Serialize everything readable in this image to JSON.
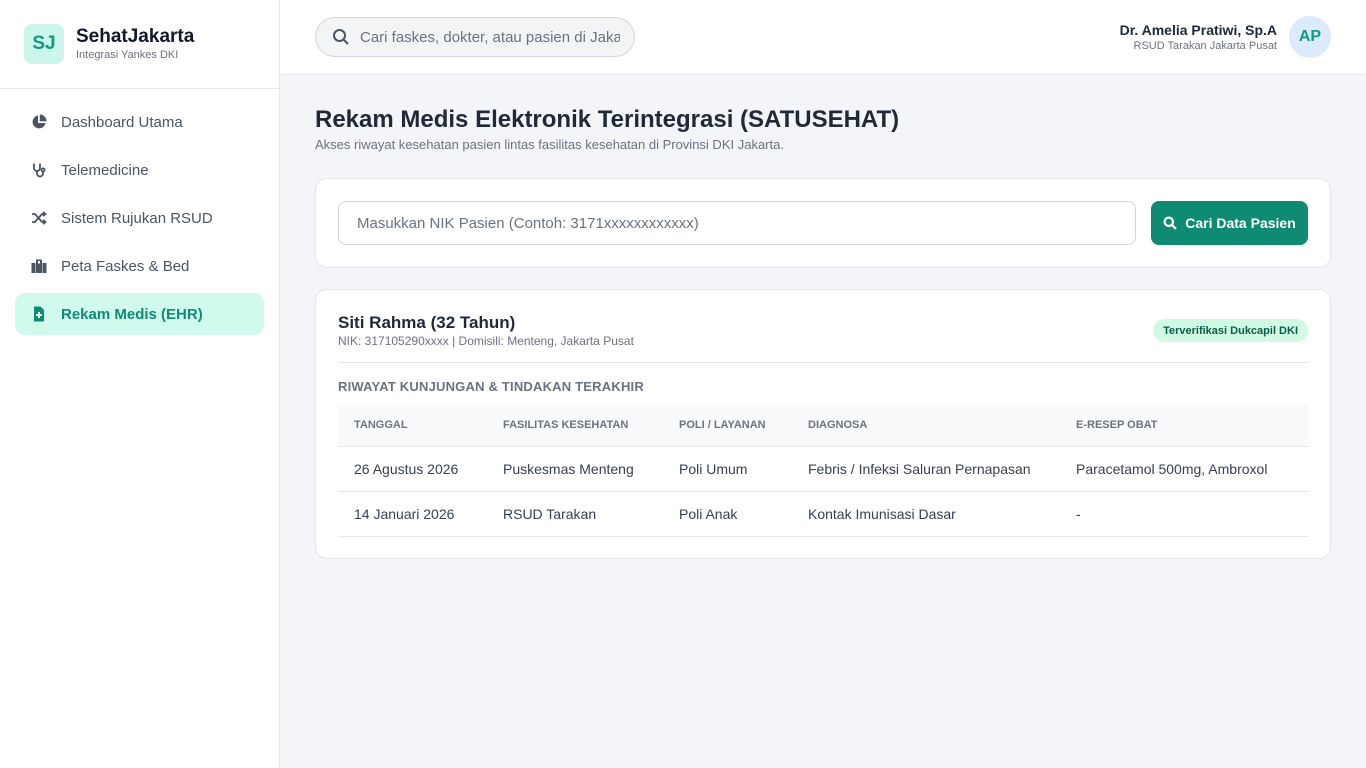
{
  "brand": {
    "logo": "SJ",
    "name": "SehatJakarta",
    "subtitle": "Integrasi Yankes DKI"
  },
  "sidebar": {
    "items": [
      {
        "label": "Dashboard Utama",
        "icon": "pie-chart-icon"
      },
      {
        "label": "Telemedicine",
        "icon": "stethoscope-icon"
      },
      {
        "label": "Sistem Rujukan RSUD",
        "icon": "shuffle-icon"
      },
      {
        "label": "Peta Faskes & Bed",
        "icon": "hospital-building-icon"
      },
      {
        "label": "Rekam Medis (EHR)",
        "icon": "medical-file-icon",
        "active": true
      }
    ]
  },
  "topbar": {
    "search_placeholder": "Cari faskes, dokter, atau pasien di Jakarta",
    "user": {
      "name": "Dr. Amelia Pratiwi, Sp.A",
      "role": "RSUD Tarakan Jakarta Pusat",
      "initials": "AP"
    }
  },
  "page": {
    "title": "Rekam Medis Elektronik Terintegrasi (SATUSEHAT)",
    "subtitle": "Akses riwayat kesehatan pasien lintas fasilitas kesehatan di Provinsi DKI Jakarta."
  },
  "nik_search": {
    "placeholder": "Masukkan NIK Pasien (Contoh: 3171xxxxxxxxxxxx)",
    "button_label": "Cari Data Pasien"
  },
  "patient": {
    "name": "Siti Rahma (32 Tahun)",
    "meta": "NIK: 317105290xxxx | Domisili: Menteng, Jakarta Pusat",
    "badge": "Terverifikasi Dukcapil DKI",
    "history_title": "RIWAYAT KUNJUNGAN & TINDAKAN TERAKHIR",
    "columns": [
      "TANGGAL",
      "FASILITAS KESEHATAN",
      "POLI / LAYANAN",
      "DIAGNOSA",
      "E-RESEP OBAT"
    ],
    "rows": [
      [
        "26 Agustus 2026",
        "Puskesmas Menteng",
        "Poli Umum",
        "Febris / Infeksi Saluran Pernapasan",
        "Paracetamol 500mg, Ambroxol"
      ],
      [
        "14 Januari 2026",
        "RSUD Tarakan",
        "Poli Anak",
        "Kontak Imunisasi Dasar",
        "-"
      ]
    ]
  },
  "colors": {
    "accent": "#0f8a73",
    "accent_light": "#d1faef",
    "badge_bg": "#d1fae5",
    "background": "#f3f5f8"
  }
}
